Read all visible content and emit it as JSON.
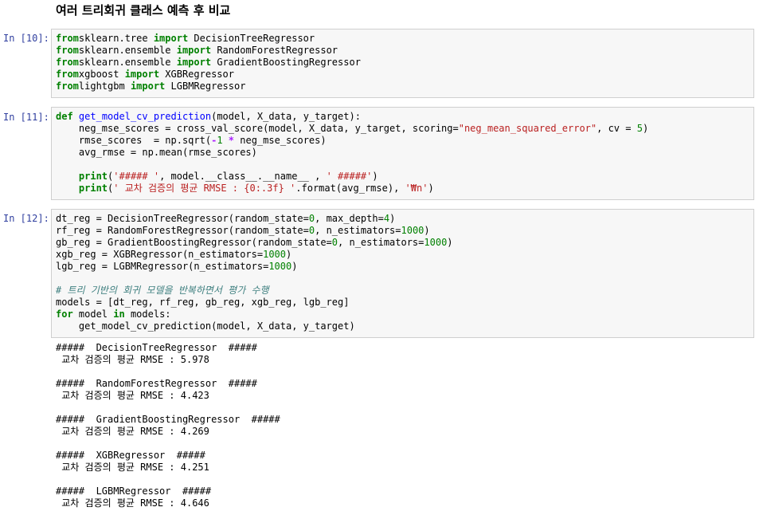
{
  "heading": "여러 트리회귀 클래스 예측 후 비교",
  "cells": [
    {
      "prompt": "In [10]:",
      "lines": [
        [
          [
            "kw",
            "from"
          ],
          [
            "",
            "sklearn.tree "
          ],
          [
            "kw",
            "import"
          ],
          [
            "",
            " DecisionTreeRegressor"
          ]
        ],
        [
          [
            "kw",
            "from"
          ],
          [
            "",
            "sklearn.ensemble "
          ],
          [
            "kw",
            "import"
          ],
          [
            "",
            " RandomForestRegressor"
          ]
        ],
        [
          [
            "kw",
            "from"
          ],
          [
            "",
            "sklearn.ensemble "
          ],
          [
            "kw",
            "import"
          ],
          [
            "",
            " GradientBoostingRegressor"
          ]
        ],
        [
          [
            "kw",
            "from"
          ],
          [
            "",
            "xgboost "
          ],
          [
            "kw",
            "import"
          ],
          [
            "",
            " XGBRegressor"
          ]
        ],
        [
          [
            "kw",
            "from"
          ],
          [
            "",
            "lightgbm "
          ],
          [
            "kw",
            "import"
          ],
          [
            "",
            " LGBMRegressor"
          ]
        ]
      ]
    },
    {
      "prompt": "In [11]:",
      "lines": [
        [
          [
            "kw",
            "def"
          ],
          [
            "",
            " "
          ],
          [
            "fn",
            "get_model_cv_prediction"
          ],
          [
            "",
            "(model, X_data, y_target):"
          ]
        ],
        [
          [
            "",
            "    neg_mse_scores = cross_val_score(model, X_data, y_target, scoring="
          ],
          [
            "str",
            "\"neg_mean_squared_error\""
          ],
          [
            "",
            ", cv = "
          ],
          [
            "num",
            "5"
          ],
          [
            "",
            ")"
          ]
        ],
        [
          [
            "",
            "    rmse_scores  = np.sqrt("
          ],
          [
            "op",
            "-"
          ],
          [
            "num",
            "1"
          ],
          [
            "",
            " "
          ],
          [
            "op",
            "*"
          ],
          [
            "",
            " neg_mse_scores)"
          ]
        ],
        [
          [
            "",
            "    avg_rmse = np.mean(rmse_scores)"
          ]
        ],
        [
          [
            "",
            ""
          ]
        ],
        [
          [
            "",
            "    "
          ],
          [
            "kw",
            "print"
          ],
          [
            "",
            "("
          ],
          [
            "str",
            "'##### '"
          ],
          [
            "",
            ", model.__class__.__name__ , "
          ],
          [
            "str",
            "' #####'"
          ],
          [
            "",
            ")"
          ]
        ],
        [
          [
            "",
            "    "
          ],
          [
            "kw",
            "print"
          ],
          [
            "",
            "("
          ],
          [
            "str",
            "' 교차 검증의 평균 RMSE : {0:.3f} '"
          ],
          [
            "",
            ".format(avg_rmse), "
          ],
          [
            "str",
            "'₩n'"
          ],
          [
            "",
            ")"
          ]
        ]
      ]
    },
    {
      "prompt": "In [12]:",
      "lines": [
        [
          [
            "",
            "dt_reg = DecisionTreeRegressor(random_state="
          ],
          [
            "num",
            "0"
          ],
          [
            "",
            ", max_depth="
          ],
          [
            "num",
            "4"
          ],
          [
            "",
            ")"
          ]
        ],
        [
          [
            "",
            "rf_reg = RandomForestRegressor(random_state="
          ],
          [
            "num",
            "0"
          ],
          [
            "",
            ", n_estimators="
          ],
          [
            "num",
            "1000"
          ],
          [
            "",
            ")"
          ]
        ],
        [
          [
            "",
            "gb_reg = GradientBoostingRegressor(random_state="
          ],
          [
            "num",
            "0"
          ],
          [
            "",
            ", n_estimators="
          ],
          [
            "num",
            "1000"
          ],
          [
            "",
            ")"
          ]
        ],
        [
          [
            "",
            "xgb_reg = XGBRegressor(n_estimators="
          ],
          [
            "num",
            "1000"
          ],
          [
            "",
            ")"
          ]
        ],
        [
          [
            "",
            "lgb_reg = LGBMRegressor(n_estimators="
          ],
          [
            "num",
            "1000"
          ],
          [
            "",
            ")"
          ]
        ],
        [
          [
            "",
            ""
          ]
        ],
        [
          [
            "cm",
            "# 트리 기반의 회귀 모델을 반복하면서 평가 수행"
          ]
        ],
        [
          [
            "",
            "models = [dt_reg, rf_reg, gb_reg, xgb_reg, lgb_reg]"
          ]
        ],
        [
          [
            "kw",
            "for"
          ],
          [
            "",
            " model "
          ],
          [
            "kw",
            "in"
          ],
          [
            "",
            " models:"
          ]
        ],
        [
          [
            "",
            "    get_model_cv_prediction(model, X_data, y_target)"
          ]
        ]
      ]
    }
  ],
  "output_lines": [
    "#####  DecisionTreeRegressor  #####",
    " 교차 검증의 평균 RMSE : 5.978",
    "",
    "#####  RandomForestRegressor  #####",
    " 교차 검증의 평균 RMSE : 4.423",
    "",
    "#####  GradientBoostingRegressor  #####",
    " 교차 검증의 평균 RMSE : 4.269",
    "",
    "#####  XGBRegressor  #####",
    " 교차 검증의 평균 RMSE : 4.251",
    "",
    "#####  LGBMRegressor  #####",
    " 교차 검증의 평균 RMSE : 4.646"
  ],
  "colors": {
    "keyword": "#008000",
    "function": "#0000ff",
    "string": "#ba2121",
    "number": "#008000",
    "comment": "#408080",
    "prompt": "#303f9f"
  }
}
